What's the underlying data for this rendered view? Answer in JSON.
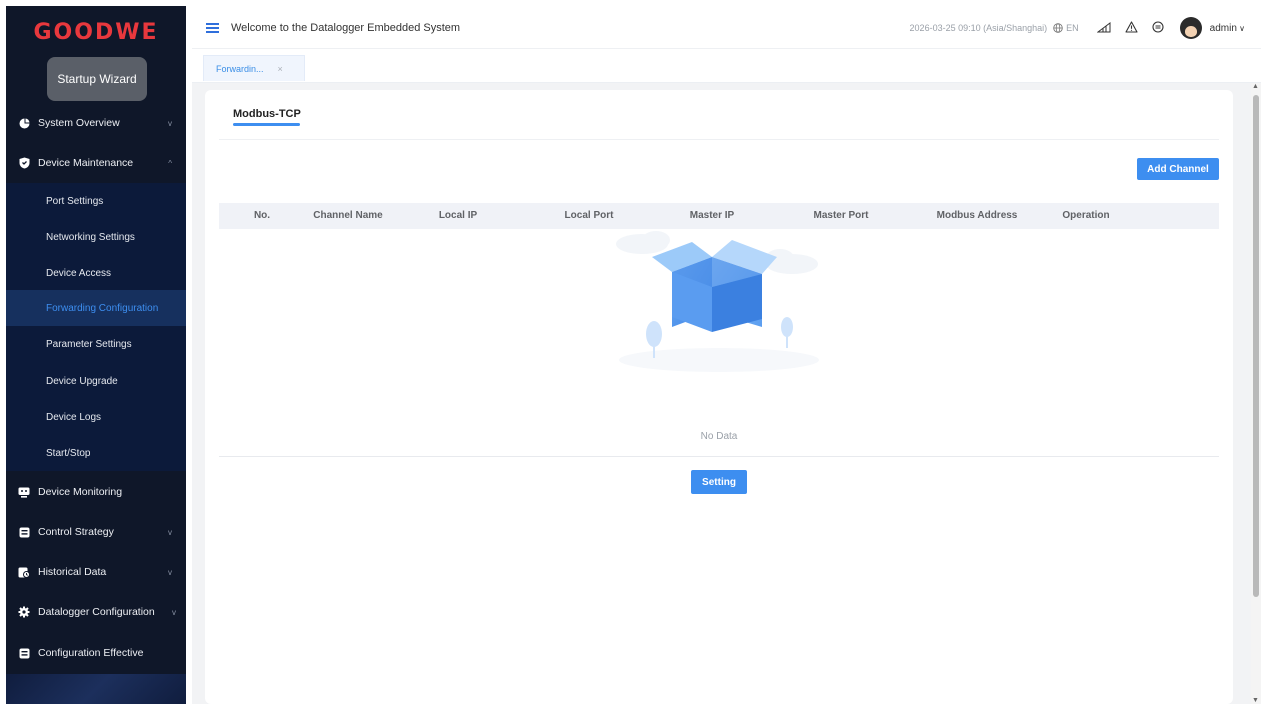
{
  "brand": {
    "logo": "GOODWE",
    "logo_color": "#e8383d"
  },
  "sidebar": {
    "wizard_label": "Startup Wizard",
    "items": [
      {
        "label": "System Overview",
        "icon": "pie-chart-icon",
        "caret": "v"
      },
      {
        "label": "Device Maintenance",
        "icon": "shield-icon",
        "caret": "^"
      },
      {
        "label": "Device Monitoring",
        "icon": "monitor-icon",
        "caret": ""
      },
      {
        "label": "Control Strategy",
        "icon": "strategy-icon",
        "caret": "v"
      },
      {
        "label": "Historical Data",
        "icon": "history-icon",
        "caret": "v"
      },
      {
        "label": "Datalogger Configuration",
        "icon": "gear-icon",
        "caret": "v"
      },
      {
        "label": "Configuration Effective",
        "icon": "config-icon",
        "caret": ""
      }
    ],
    "sub_items": [
      {
        "label": "Port Settings"
      },
      {
        "label": "Networking Settings"
      },
      {
        "label": "Device Access"
      },
      {
        "label": "Forwarding Configuration",
        "active": true
      },
      {
        "label": "Parameter Settings"
      },
      {
        "label": "Device Upgrade"
      },
      {
        "label": "Device Logs"
      },
      {
        "label": "Start/Stop"
      }
    ]
  },
  "header": {
    "welcome": "Welcome to the Datalogger Embedded System",
    "datetime": "2026-03-25 09:10 (Asia/Shanghai)",
    "language": "EN",
    "user": "admin"
  },
  "tabs": [
    {
      "label": "Forwardin...",
      "close": "×"
    }
  ],
  "main": {
    "section_title": "Modbus-TCP",
    "add_button": "Add Channel",
    "columns": [
      "No.",
      "Channel Name",
      "Local IP",
      "Local Port",
      "Master IP",
      "Master Port",
      "Modbus Address",
      "Operation"
    ],
    "rows": [],
    "empty_text": "No Data",
    "setting_button": "Setting"
  },
  "colors": {
    "accent": "#3d8ef0",
    "sidebar_bg": "#0f1729",
    "submenu_bg": "#0c1a3a",
    "active_bg": "#16305e"
  }
}
